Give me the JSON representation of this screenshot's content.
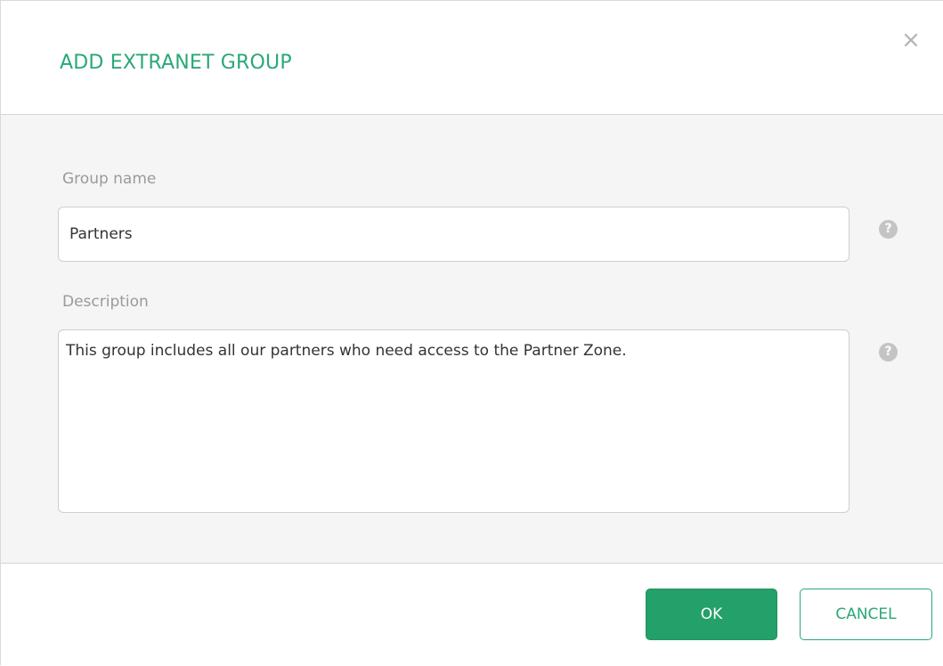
{
  "dialog": {
    "title": "ADD EXTRANET GROUP",
    "close_icon": "close-icon",
    "accent_color": "#2aa876"
  },
  "form": {
    "group_name": {
      "label": "Group name",
      "value": "Partners",
      "help_icon": "question-icon",
      "help_glyph": "?"
    },
    "description": {
      "label": "Description",
      "value": "This group includes all our partners who need access to the Partner Zone.",
      "help_icon": "question-icon",
      "help_glyph": "?"
    }
  },
  "footer": {
    "ok_label": "OK",
    "cancel_label": "CANCEL"
  }
}
